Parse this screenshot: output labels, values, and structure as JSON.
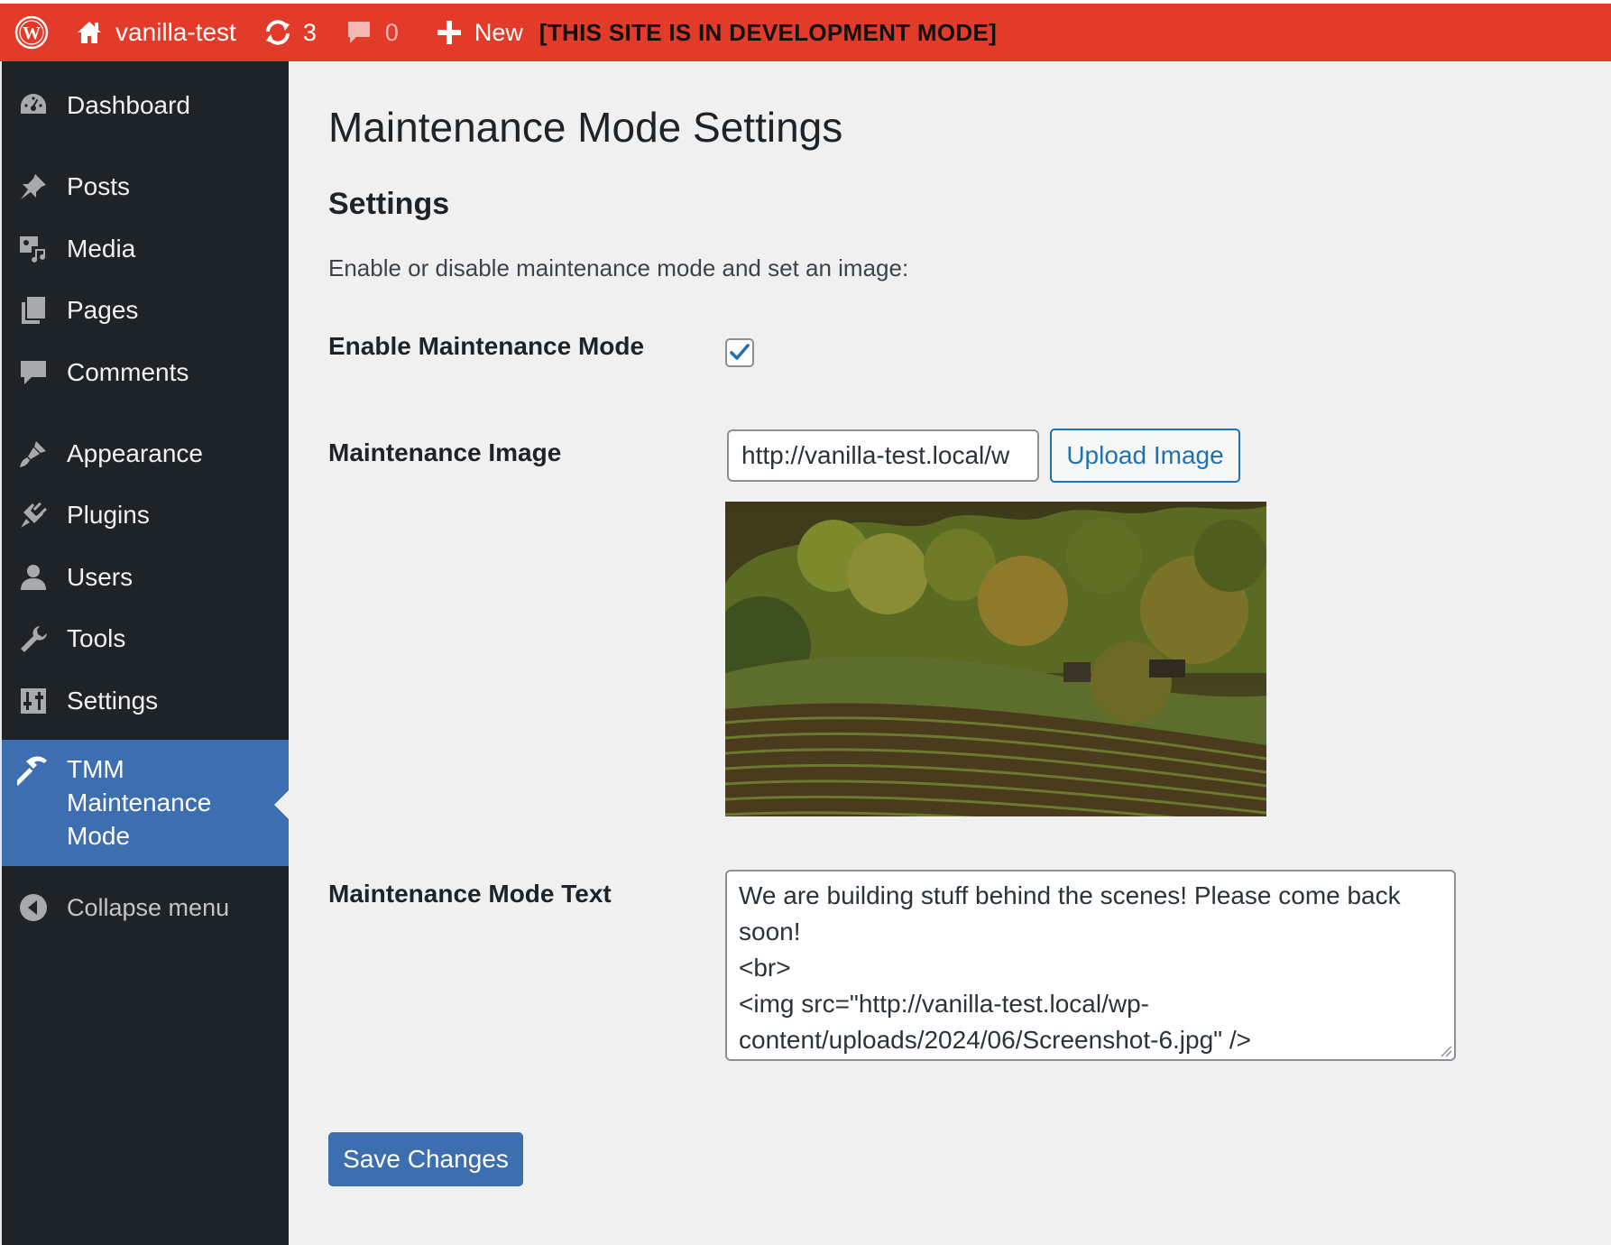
{
  "admin_bar": {
    "logo_icon": "wordpress-logo-icon",
    "site_name": "vanilla-test",
    "updates_count": "3",
    "comments_count": "0",
    "new_label": "New",
    "dev_notice": "[THIS SITE IS IN DEVELOPMENT MODE]",
    "bar_color": "#e23b2a"
  },
  "sidebar": {
    "items": [
      {
        "label": "Dashboard",
        "icon": "dashboard-icon"
      },
      {
        "label": "Posts",
        "icon": "pin-icon"
      },
      {
        "label": "Media",
        "icon": "media-icon"
      },
      {
        "label": "Pages",
        "icon": "pages-icon"
      },
      {
        "label": "Comments",
        "icon": "comment-icon"
      },
      {
        "label": "Appearance",
        "icon": "paintbrush-icon"
      },
      {
        "label": "Plugins",
        "icon": "plugin-icon"
      },
      {
        "label": "Users",
        "icon": "user-icon"
      },
      {
        "label": "Tools",
        "icon": "wrench-icon"
      },
      {
        "label": "Settings",
        "icon": "settings-sliders-icon"
      }
    ],
    "current": {
      "label_line1": "TMM",
      "label_line2": "Maintenance",
      "label_line3": "Mode",
      "icon": "hammer-icon"
    },
    "collapse_label": "Collapse menu",
    "background": "#1d2327",
    "accent": "#3c6eb0"
  },
  "main": {
    "page_title": "Maintenance Mode Settings",
    "section_title": "Settings",
    "section_description": "Enable or disable maintenance mode and set an image:",
    "enable_label": "Enable Maintenance Mode",
    "enable_checked": true,
    "image_label": "Maintenance Image",
    "image_url_value": "http://vanilla-test.local/w",
    "upload_button": "Upload Image",
    "text_label": "Maintenance Mode Text",
    "text_value": "We are building stuff behind the scenes! Please come back soon!\n<br>\n<img src=\"http://vanilla-test.local/wp-content/uploads/2024/06/Screenshot-6.jpg\" />",
    "save_button": "Save Changes"
  }
}
